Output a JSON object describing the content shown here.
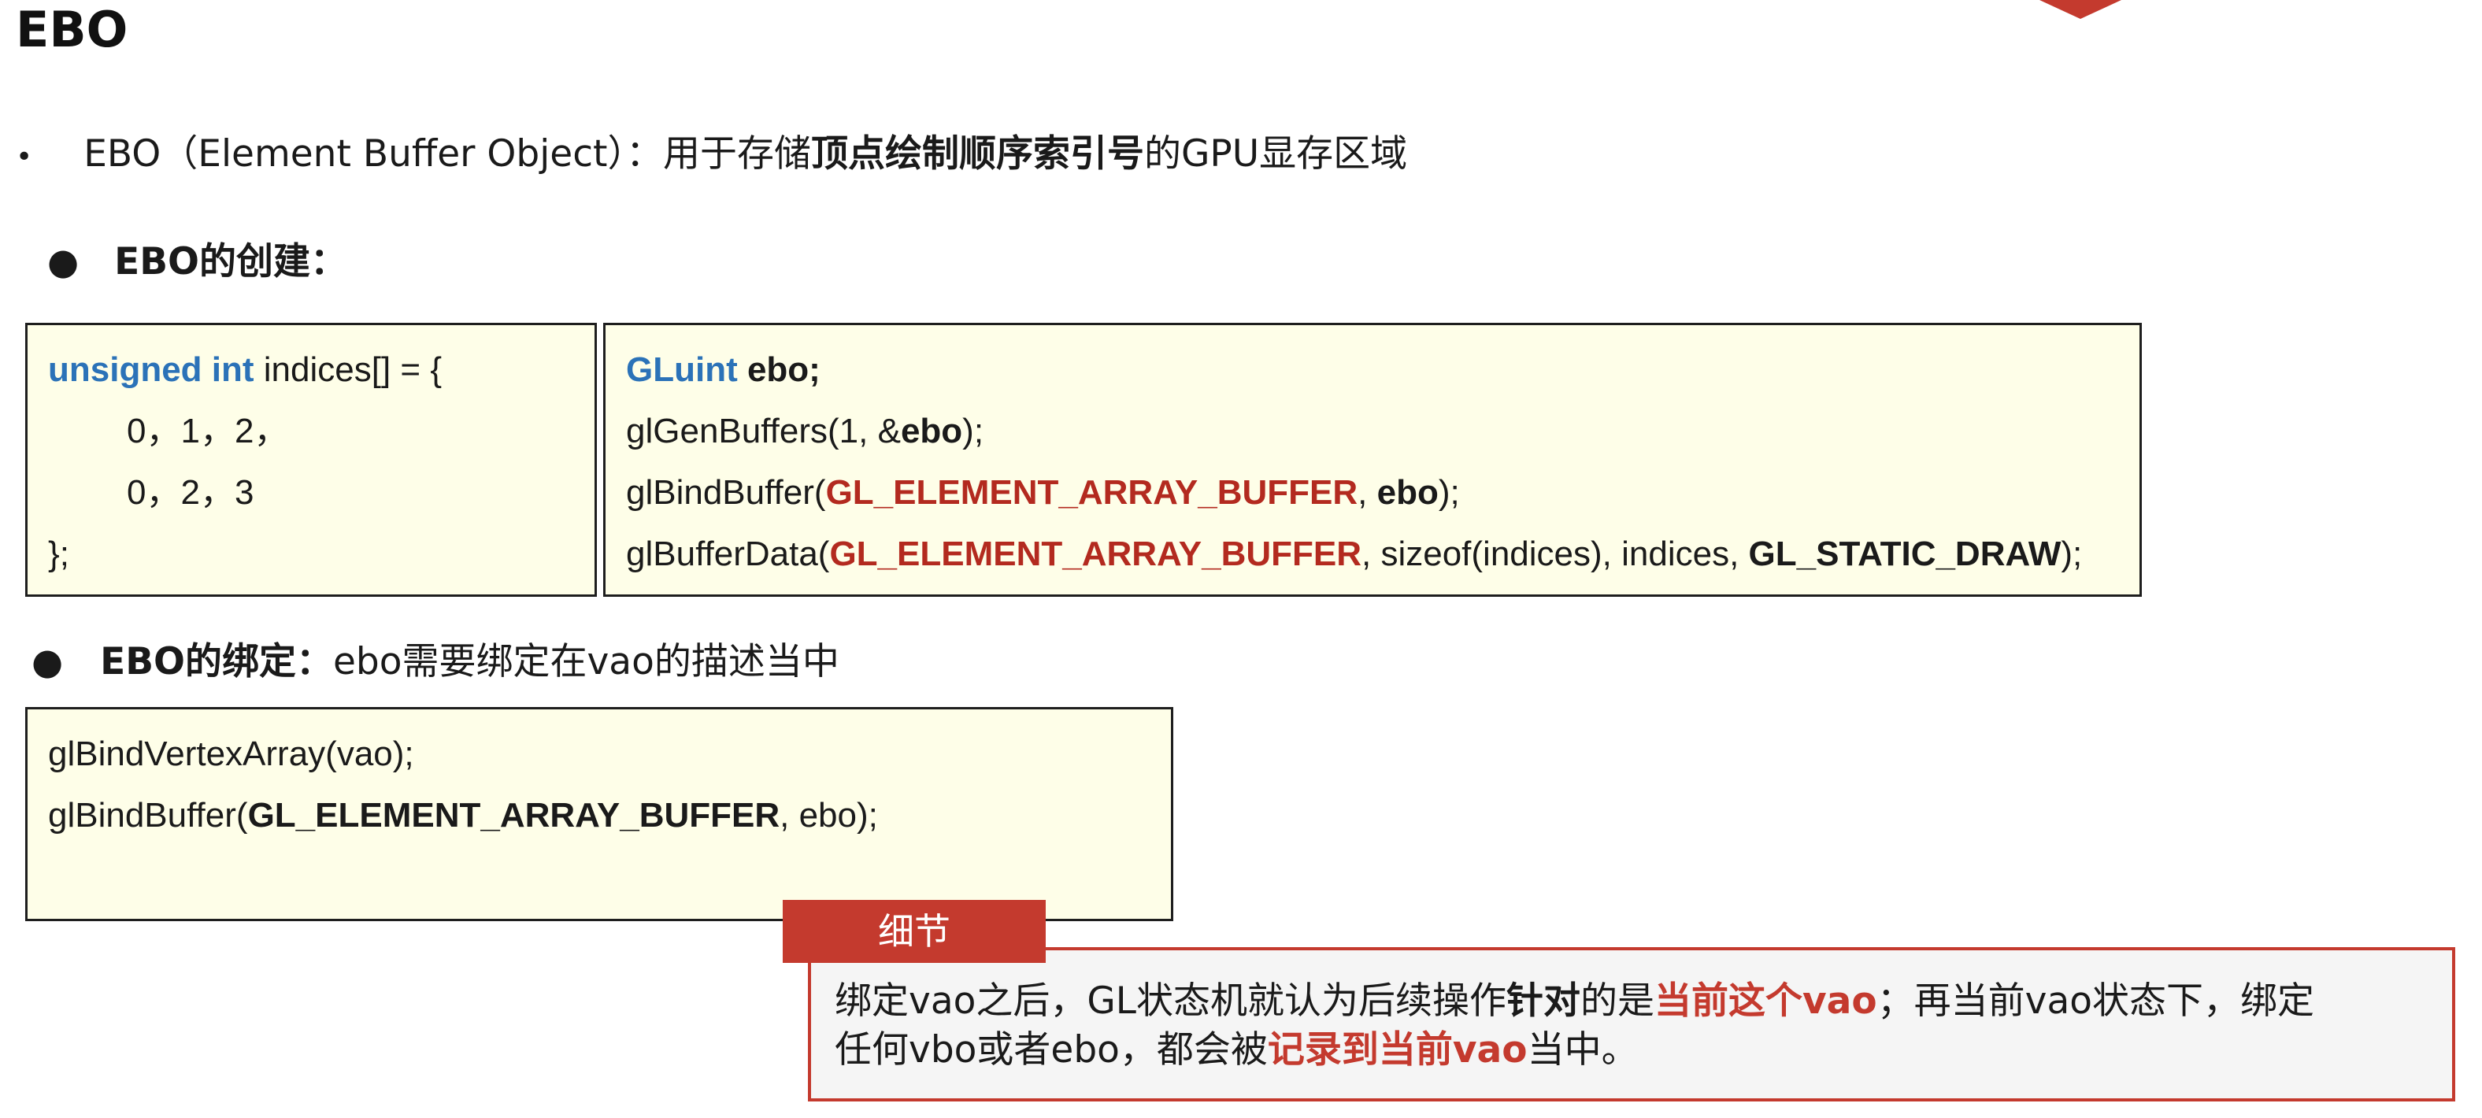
{
  "title": "EBO",
  "intro": {
    "bullet": "•",
    "pre": "EBO（Element Buffer Object）：用于存储",
    "bold": "顶点绘制顺序索引号",
    "post": "的GPU显存区域"
  },
  "creation": {
    "bullet": "●",
    "heading": "EBO的创建："
  },
  "indices_box": {
    "line1_kw": "unsigned int",
    "line1_rest": " indices[] = {",
    "line2": "0，1，2，",
    "line3": "0，2，3",
    "line4": "};"
  },
  "create_box": {
    "l1_kw": "GLuint",
    "l1_var": " ebo;",
    "l2_pre": "glGenBuffers(1, &",
    "l2_var": "ebo",
    "l2_post": ");",
    "l3_pre": "glBindBuffer(",
    "l3_const": "GL_ELEMENT_ARRAY_BUFFER",
    "l3_mid": ", ",
    "l3_var": "ebo",
    "l3_post": ");",
    "l4_pre": "glBufferData(",
    "l4_const": "GL_ELEMENT_ARRAY_BUFFER",
    "l4_mid": ", sizeof(indices), indices, ",
    "l4_const2": "GL_STATIC_DRAW",
    "l4_post": ");"
  },
  "binding": {
    "bullet": "●",
    "heading": "EBO的绑定：",
    "text": "ebo需要绑定在vao的描述当中"
  },
  "bind_box": {
    "l1": "glBindVertexArray(vao);",
    "l2_pre": "glBindBuffer(",
    "l2_const": "GL_ELEMENT_ARRAY_BUFFER",
    "l2_post": ", ebo);"
  },
  "note": {
    "tag": "细节",
    "p1": "绑定vao之后，GL状态机就认为后续操作",
    "b1": "针对",
    "p2": "的是",
    "h1": "当前这个vao",
    "p3": "；再当前vao状态下，绑定",
    "p4": "任何vbo或者ebo，都会被",
    "h2": "记录到当前vao",
    "p5": "当中。"
  },
  "colors": {
    "keyword_blue": "#2b72b8",
    "constant_red": "#b32a1f",
    "accent_red": "#c43a2e",
    "codebox_bg": "#fefee8"
  }
}
